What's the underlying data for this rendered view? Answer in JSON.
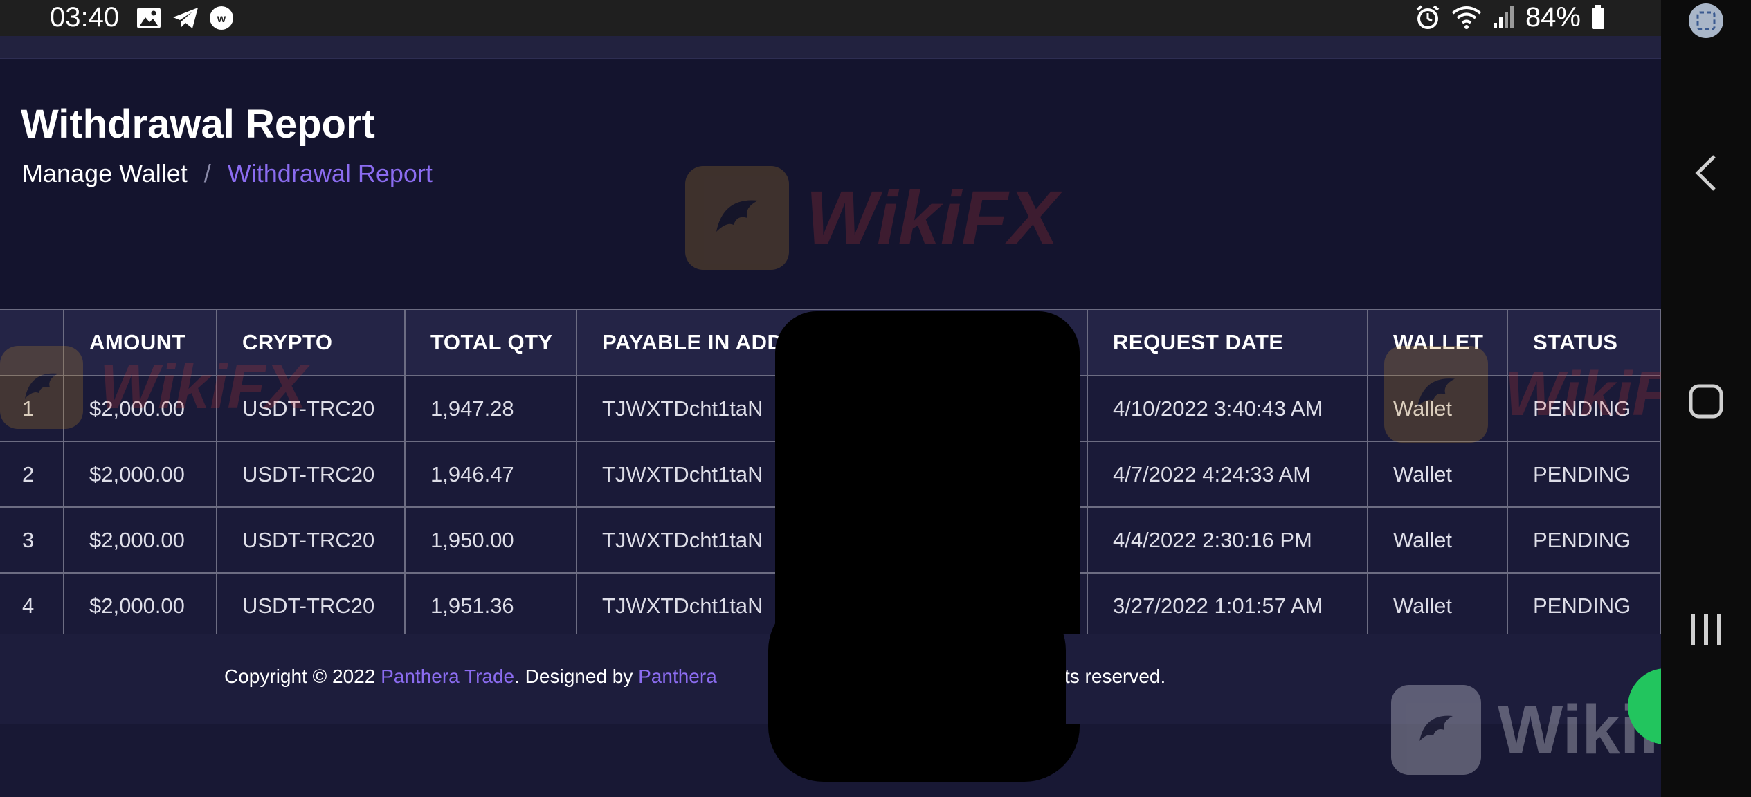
{
  "status_bar": {
    "time": "03:40",
    "battery": "84%"
  },
  "header": {
    "title": "Withdrawal Report",
    "breadcrumb": {
      "parent": "Manage Wallet",
      "separator": "/",
      "current": "Withdrawal Report"
    }
  },
  "table": {
    "columns": [
      "",
      "AMOUNT",
      "CRYPTO",
      "TOTAL QTY",
      "PAYABLE IN ADD",
      "REQUEST DATE",
      "WALLET",
      "STATUS"
    ],
    "rows": [
      {
        "index": "1",
        "amount": "$2,000.00",
        "crypto": "USDT-TRC20",
        "total_qty": "1,947.28",
        "address": "TJWXTDcht1taN",
        "request_date": "4/10/2022 3:40:43 AM",
        "wallet": "Wallet",
        "status": "PENDING"
      },
      {
        "index": "2",
        "amount": "$2,000.00",
        "crypto": "USDT-TRC20",
        "total_qty": "1,946.47",
        "address": "TJWXTDcht1taN",
        "request_date": "4/7/2022 4:24:33 AM",
        "wallet": "Wallet",
        "status": "PENDING"
      },
      {
        "index": "3",
        "amount": "$2,000.00",
        "crypto": "USDT-TRC20",
        "total_qty": "1,950.00",
        "address": "TJWXTDcht1taN",
        "request_date": "4/4/2022 2:30:16 PM",
        "wallet": "Wallet",
        "status": "PENDING"
      },
      {
        "index": "4",
        "amount": "$2,000.00",
        "crypto": "USDT-TRC20",
        "total_qty": "1,951.36",
        "address": "TJWXTDcht1taN",
        "request_date": "3/27/2022 1:01:57 AM",
        "wallet": "Wallet",
        "status": "PENDING"
      }
    ]
  },
  "footer": {
    "prefix": "Copyright © 2022 ",
    "brand_link": "Panthera Trade",
    "middle": ". Designed by ",
    "designer_link": "Panthera",
    "suffix": "ts reserved."
  },
  "watermark": {
    "text": "WikiFX"
  },
  "colors": {
    "accent": "#8b6cf0",
    "background": "#181834",
    "header_bg": "#14142e",
    "table_header_bg": "#242446",
    "border": "#6c6c82"
  },
  "icons": {
    "status_left": [
      "image-icon",
      "telegram-icon",
      "app-icon"
    ],
    "status_right": [
      "alarm-icon",
      "wifi-icon",
      "signal-icon",
      "battery-icon"
    ],
    "nav": [
      "back-icon",
      "home-icon",
      "recents-icon",
      "screenshot-icon"
    ]
  }
}
